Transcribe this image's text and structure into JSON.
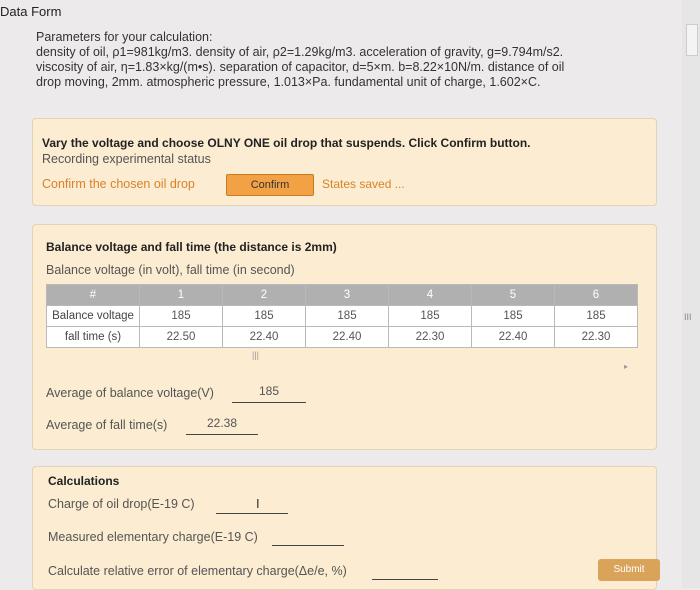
{
  "form_title": "Data Form",
  "params": {
    "line1": "Parameters for your calculation:",
    "line2": "density of oil, ρ1=981kg/m3. density of air, ρ2=1.29kg/m3. acceleration of gravity, g=9.794m/s2.",
    "line3": "viscosity of air, η=1.83×kg/(m•s). separation of capacitor, d=5×m.  b=8.22×10N/m. distance of oil",
    "line4": "drop moving, 2mm. atmospheric pressure, 1.013×Pa. fundamental unit of charge, 1.602×C."
  },
  "vary_panel": {
    "instruction": "Vary the voltage and choose OLNY ONE oil drop that suspends. Click Confirm button.",
    "recording": "Recording experimental status",
    "confirm_label": "Confirm the chosen oil drop",
    "confirm_button": "Confirm",
    "states_saved": "States saved ..."
  },
  "balance_panel": {
    "heading": "Balance voltage and fall time (the distance is 2mm)",
    "subheading": "Balance voltage (in volt), fall time (in second)",
    "headers": [
      "#",
      "1",
      "2",
      "3",
      "4",
      "5",
      "6"
    ],
    "rows": [
      {
        "label": "Balance voltage",
        "values": [
          "185",
          "185",
          "185",
          "185",
          "185",
          "185"
        ]
      },
      {
        "label": "fall time (s)",
        "values": [
          "22.50",
          "22.40",
          "22.40",
          "22.30",
          "22.40",
          "22.30"
        ]
      }
    ],
    "avg_voltage_label": "Average of balance voltage(V)",
    "avg_voltage_value": "185",
    "avg_time_label": "Average of fall time(s)",
    "avg_time_value": "22.38"
  },
  "calc_panel": {
    "heading": "Calculations",
    "charge_label": "Charge of oil drop(E-19 C)",
    "measured_label": "Measured elementary charge(E-19 C)",
    "error_label": "Calculate relative error of elementary charge(Δe/e, %)"
  },
  "submit_label": "Submit"
}
